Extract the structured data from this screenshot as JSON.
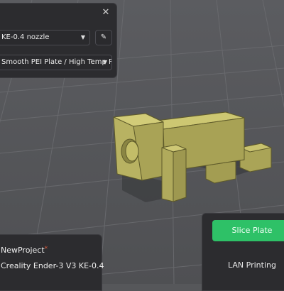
{
  "printer_panel": {
    "close_icon": "close-icon",
    "nozzle_select_value": "KE-0.4 nozzle",
    "plate_select_value": "Smooth PEI Plate / High Temp P...",
    "edit_icon": "pencil-icon"
  },
  "project_panel": {
    "project_name": "NewProject",
    "modified_marker": "*",
    "printer_name": "Creality Ender-3 V3 KE-0.4"
  },
  "actions": {
    "slice_label": "Slice Plate",
    "lan_label": "LAN Printing"
  },
  "colors": {
    "accent_green": "#2ec167",
    "model_olive": "#b3ad5d",
    "panel_bg": "#2c2c2f",
    "viewport_bg": "#56575a"
  }
}
